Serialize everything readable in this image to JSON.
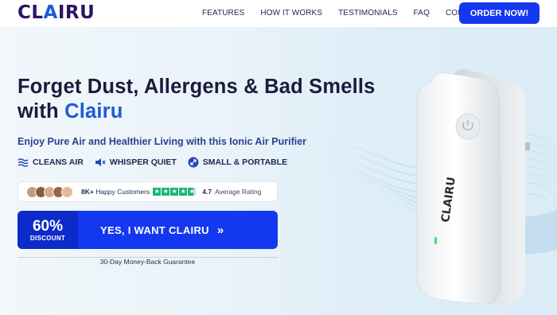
{
  "header": {
    "logo_main": "CL",
    "logo_accent": "A",
    "logo_tail": "IRU",
    "nav": [
      "FEATURES",
      "HOW IT WORKS",
      "TESTIMONIALS",
      "FAQ",
      "CONTACT US"
    ],
    "order_label": "ORDER NOW!"
  },
  "hero": {
    "headline_line1": "Forget Dust, Allergens & Bad Smells",
    "headline_with": "with ",
    "headline_brand": "Clairu",
    "subline": "Enjoy Pure Air and Healthier Living with this Ionic Air Purifier",
    "features": [
      {
        "icon": "waves-icon",
        "label": "CLEANS AIR"
      },
      {
        "icon": "speaker-mute-icon",
        "label": "WHISPER QUIET"
      },
      {
        "icon": "expand-icon",
        "label": "SMALL & PORTABLE"
      }
    ],
    "social": {
      "customers_bold": "8K+",
      "customers_text": " Happy Customers",
      "rating": "4.7",
      "rating_label": "Average Rating",
      "stars": 4.7
    },
    "cta": {
      "discount_pct": "60%",
      "discount_label": "DISCOUNT",
      "label": "YES, I WANT CLAIRU",
      "arrow": "»"
    },
    "guarantee": "30-Day Money-Back Guarantee",
    "device_brand": "CLAIRU"
  },
  "colors": {
    "accent": "#1437f0",
    "brand": "#1e5bd6",
    "dark": "#1c1a3c",
    "trust_green": "#19b775"
  }
}
